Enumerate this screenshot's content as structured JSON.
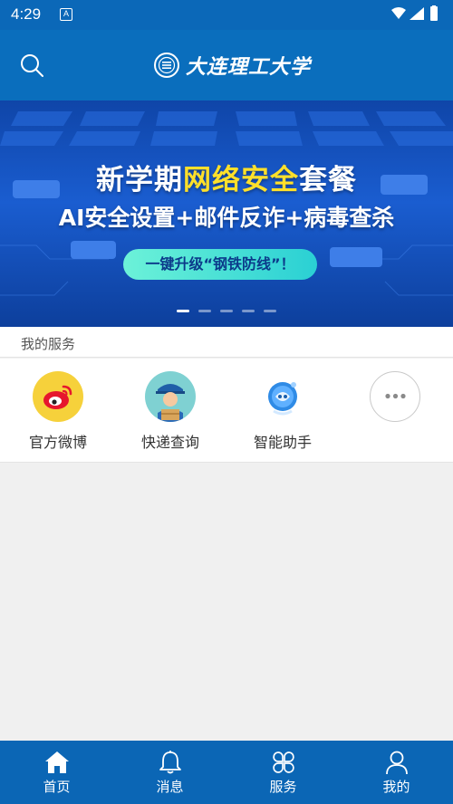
{
  "status": {
    "time": "4:29",
    "notification": "A"
  },
  "header": {
    "title": "大连理工大学"
  },
  "banner": {
    "title_part1": "新学期",
    "title_highlight": "网络安全",
    "title_part2": "套餐",
    "subtitle": "AI安全设置+邮件反诈+病毒查杀",
    "cta": "一键升级“钢铁防线”！",
    "slide_count": 5,
    "active_slide": 0
  },
  "services": {
    "section_title": "我的服务",
    "items": [
      {
        "label": "官方微博",
        "icon": "weibo-icon"
      },
      {
        "label": "快递查询",
        "icon": "courier-icon"
      },
      {
        "label": "智能助手",
        "icon": "assistant-icon"
      },
      {
        "label": "",
        "icon": "more-icon"
      }
    ]
  },
  "nav": {
    "items": [
      {
        "label": "首页",
        "icon": "home-icon",
        "active": true
      },
      {
        "label": "消息",
        "icon": "bell-icon",
        "active": false
      },
      {
        "label": "服务",
        "icon": "clover-icon",
        "active": false
      },
      {
        "label": "我的",
        "icon": "user-icon",
        "active": false
      }
    ]
  },
  "colors": {
    "brand_blue": "#0a6ebd",
    "nav_blue": "#0b66b5",
    "highlight_yellow": "#ffe02a",
    "cta_teal": "#2ad0d4",
    "weibo_yellow": "#f6d13b",
    "weibo_red": "#e6162d"
  }
}
